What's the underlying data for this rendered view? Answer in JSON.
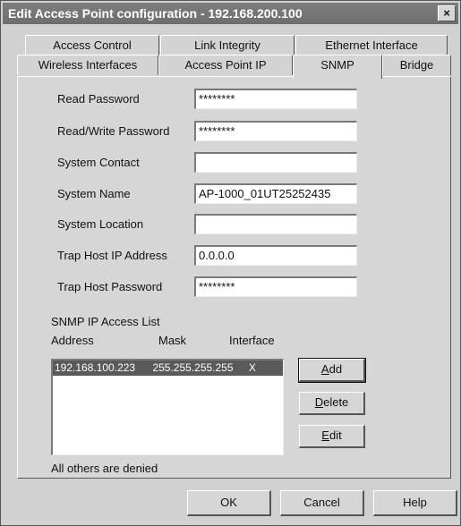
{
  "window": {
    "title": "Edit Access Point configuration - 192.168.200.100",
    "close_glyph": "×"
  },
  "tabs": {
    "row_back": [
      "Access Control",
      "Link Integrity",
      "Ethernet Interface"
    ],
    "row_front": [
      "Wireless Interfaces",
      "Access Point IP",
      "SNMP",
      "Bridge"
    ],
    "active": "SNMP"
  },
  "form": {
    "read_password": {
      "label": "Read Password",
      "value": "********"
    },
    "readwrite_password": {
      "label": "Read/Write Password",
      "value": "********"
    },
    "system_contact": {
      "label": "System Contact",
      "value": ""
    },
    "system_name": {
      "label": "System Name",
      "value": "AP-1000_01UT25252435"
    },
    "system_location": {
      "label": "System Location",
      "value": ""
    },
    "trap_host_ip": {
      "label": "Trap Host IP Address",
      "value": "0.0.0.0"
    },
    "trap_host_password": {
      "label": "Trap Host Password",
      "value": "********"
    }
  },
  "access_list": {
    "title": "SNMP IP Access List",
    "columns": [
      "Address",
      "Mask",
      "Interface"
    ],
    "rows": [
      {
        "address": "192.168.100.223",
        "mask": "255.255.255.255",
        "interface": "X"
      }
    ],
    "footer": "All others are denied"
  },
  "list_buttons": {
    "add": {
      "label": "Add",
      "mnemonic": "A"
    },
    "delete": {
      "label": "Delete",
      "mnemonic": "D"
    },
    "edit": {
      "label": "Edit",
      "mnemonic": "E"
    }
  },
  "dialog_buttons": {
    "ok": "OK",
    "cancel": "Cancel",
    "help": "Help"
  }
}
